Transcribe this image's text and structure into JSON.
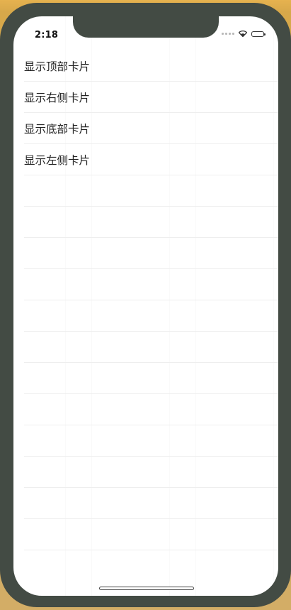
{
  "status_bar": {
    "time": "2:18",
    "icons": [
      "signal-icon",
      "wifi-icon",
      "battery-icon"
    ]
  },
  "menu": {
    "items": [
      {
        "label": "显示顶部卡片"
      },
      {
        "label": "显示右侧卡片"
      },
      {
        "label": "显示底部卡片"
      },
      {
        "label": "显示左侧卡片"
      },
      {
        "label": ""
      },
      {
        "label": ""
      },
      {
        "label": ""
      },
      {
        "label": ""
      },
      {
        "label": ""
      },
      {
        "label": ""
      },
      {
        "label": ""
      },
      {
        "label": ""
      },
      {
        "label": ""
      },
      {
        "label": ""
      },
      {
        "label": ""
      },
      {
        "label": ""
      }
    ]
  },
  "colors": {
    "background": "#e6b24f",
    "device_frame": "#434b44",
    "screen": "#ffffff",
    "divider": "#eeeeee",
    "text": "#222222"
  }
}
